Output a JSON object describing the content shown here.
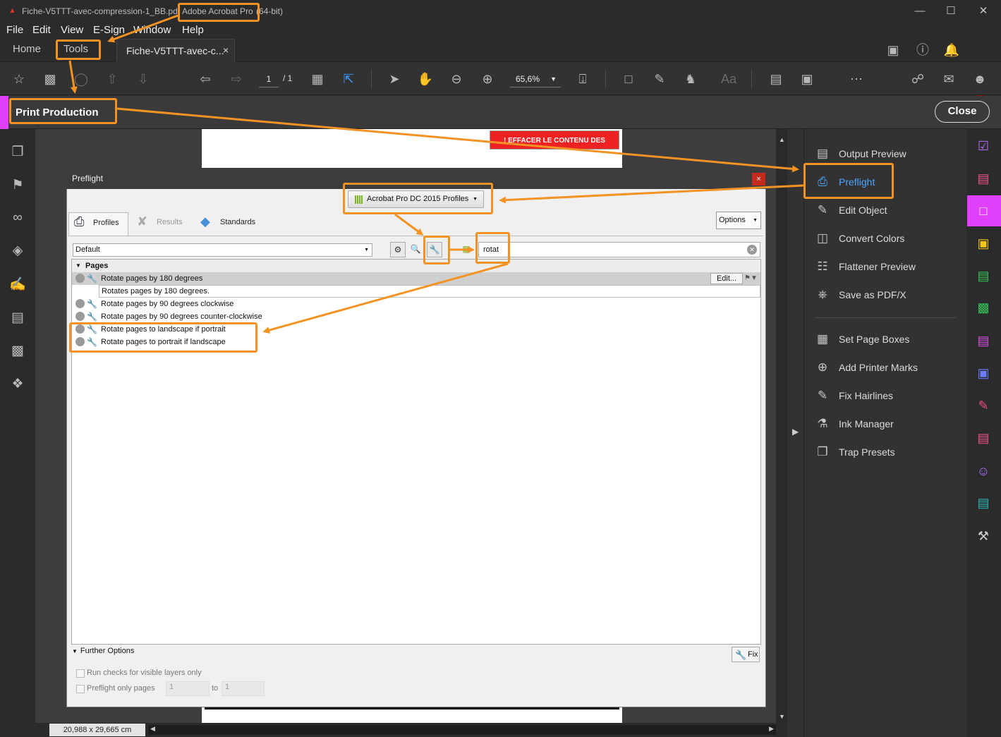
{
  "window": {
    "file_title": "Fiche-V5TTT-avec-compression-1_BB.pdf",
    "app_name": "Adobe Acrobat Pro",
    "bitness": "(64-bit)"
  },
  "menu": [
    "File",
    "Edit",
    "View",
    "E-Sign",
    "Window",
    "Help"
  ],
  "tabs": {
    "home": "Home",
    "tools": "Tools",
    "document": "Fiche-V5TTT-avec-c...",
    "doc_close": "×"
  },
  "toolbar": {
    "page_current": "1",
    "page_total": "/ 1",
    "zoom": "65,6%"
  },
  "tool_bar_header": {
    "title": "Print Production",
    "close_label": "Close",
    "accent_color": "#e040fb"
  },
  "document": {
    "red_button_text": "! EFFACER LE CONTENU DES CHAMPS !",
    "dimensions": "20,988 x 29,665 cm"
  },
  "right_panel": {
    "items_group1": [
      "Output Preview",
      "Preflight",
      "Edit Object",
      "Convert Colors",
      "Flattener Preview",
      "Save as PDF/X"
    ],
    "items_group2": [
      "Set Page Boxes",
      "Add Printer Marks",
      "Fix Hairlines",
      "Ink Manager",
      "Trap Presets"
    ],
    "selected": "Preflight"
  },
  "preflight": {
    "title": "Preflight",
    "close": "×",
    "profiles_dropdown": "Acrobat Pro DC 2015 Profiles",
    "tabs": {
      "profiles": "Profiles",
      "results": "Results",
      "standards": "Standards"
    },
    "options_label": "Options",
    "filter_select": "Default",
    "search_value": "rotat",
    "group_header": "Pages",
    "rows": [
      "Rotate pages by 180 degrees",
      "Rotate pages by 90 degrees clockwise",
      "Rotate pages by 90 degrees counter-clockwise",
      "Rotate pages to landscape if portrait",
      "Rotate pages to portrait if landscape"
    ],
    "selected_description": "Rotates pages by 180 degrees.",
    "edit_label": "Edit...",
    "further_options": "Further Options",
    "fix_label": "Fix",
    "check_visible_layers": "Run checks for visible layers only",
    "preflight_only_pages": "Preflight only pages",
    "page_from": "1",
    "to_label": "to",
    "page_to": "1"
  },
  "annotation_color": "#f39323"
}
